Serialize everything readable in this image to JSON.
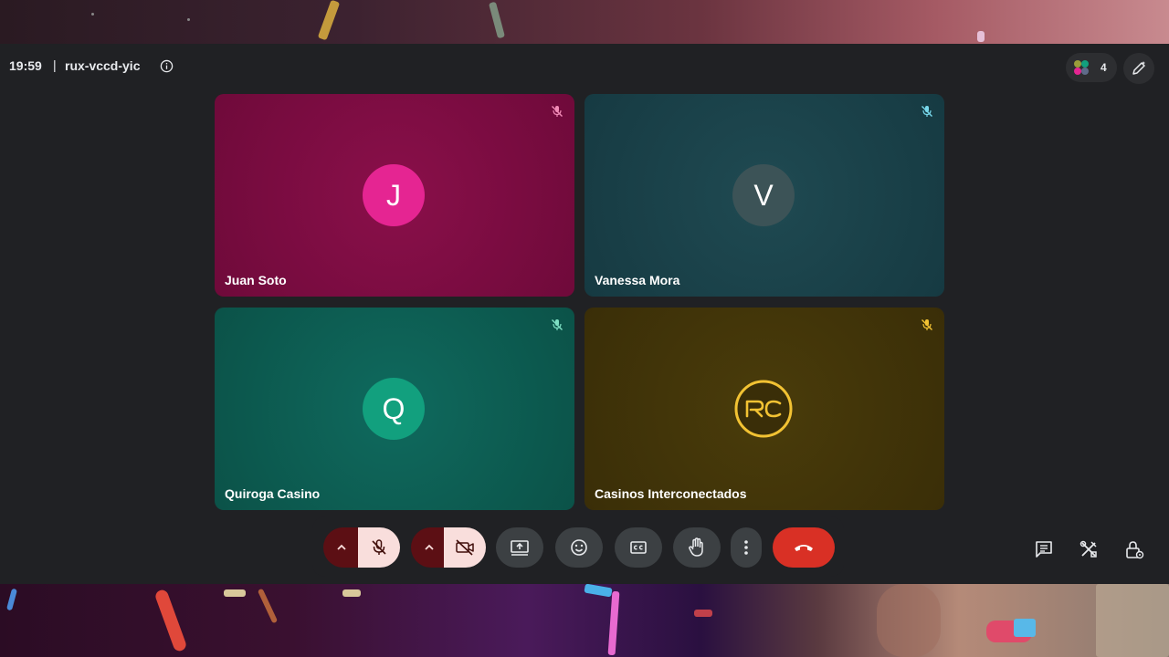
{
  "header": {
    "time": "19:59",
    "separator": "|",
    "meeting_code": "rux-vccd-yic",
    "participant_count": "4"
  },
  "tiles": [
    {
      "name": "Juan Soto",
      "initial": "J",
      "avatar_color": "#e52592"
    },
    {
      "name": "Vanessa Mora",
      "initial": "V",
      "avatar_color": "#3c5357"
    },
    {
      "name": "Quiroga Casino",
      "initial": "Q",
      "avatar_color": "#12a07e"
    },
    {
      "name": "Casinos Interconectados",
      "initial": "RC",
      "avatar_color": "#f2c233"
    }
  ],
  "controls": {
    "mic_state": "muted",
    "camera_state": "off",
    "icons": [
      "chevron-up-icon",
      "mic-off-icon",
      "chevron-up-icon",
      "camera-off-icon",
      "present-screen-icon",
      "emoji-icon",
      "captions-icon",
      "raise-hand-icon",
      "more-vert-icon",
      "hang-up-icon"
    ]
  },
  "side_icons": [
    "chat-icon",
    "activities-icon",
    "host-controls-icon"
  ],
  "colors": {
    "background": "#202124",
    "hangup": "#d93025",
    "muted_button": "#f9dedc"
  }
}
